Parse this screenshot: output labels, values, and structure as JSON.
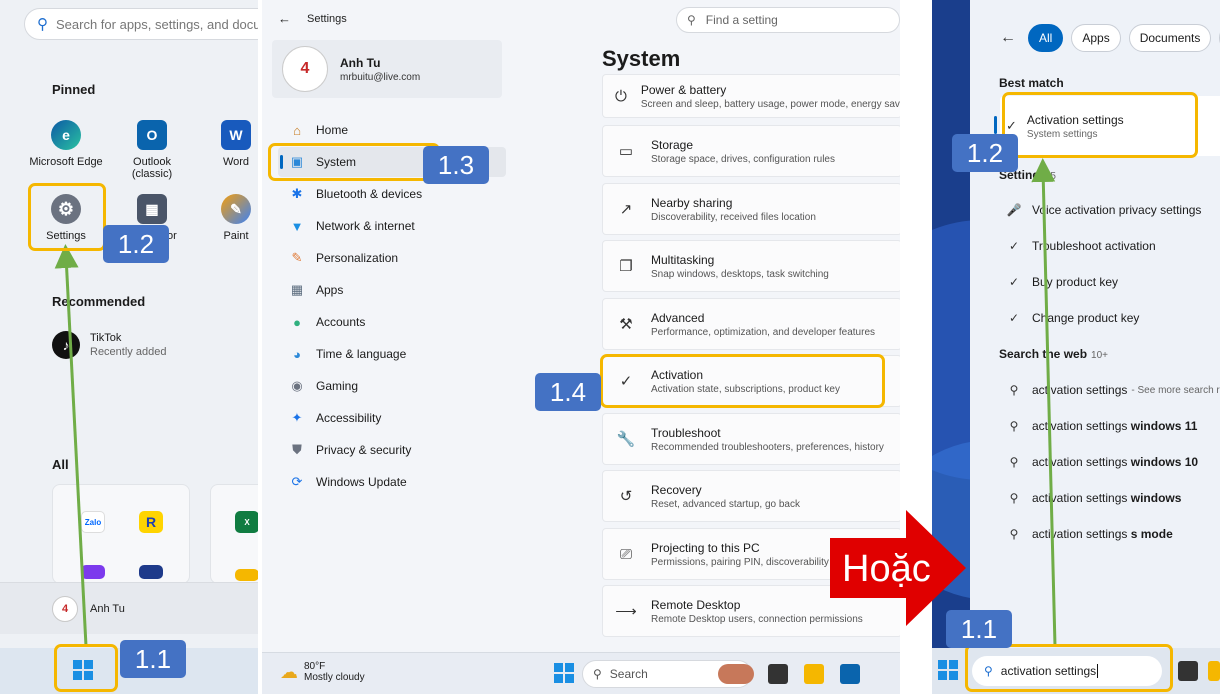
{
  "start_menu": {
    "search_placeholder": "Search for apps, settings, and documents",
    "pinned_heading": "Pinned",
    "pinned_apps": [
      "Microsoft Edge",
      "Outlook (classic)",
      "Word",
      "Settings",
      "Calculator",
      "Paint"
    ],
    "recommended_heading": "Recommended",
    "recommended_item": {
      "title": "TikTok",
      "subtitle": "Recently added"
    },
    "all_heading": "All",
    "folder_apps": [
      "Zalo"
    ],
    "user_name": "Anh Tu"
  },
  "settings": {
    "window_title": "Settings",
    "find_placeholder": "Find a setting",
    "user": {
      "name": "Anh Tu",
      "email": "mrbuitu@live.com"
    },
    "nav_items": [
      "Home",
      "System",
      "Bluetooth & devices",
      "Network & internet",
      "Personalization",
      "Apps",
      "Accounts",
      "Time & language",
      "Gaming",
      "Accessibility",
      "Privacy & security",
      "Windows Update"
    ],
    "selected_nav": "System",
    "page_title": "System",
    "cards": [
      {
        "title": "Power & battery",
        "subtitle": "Screen and sleep, battery usage, power mode, energy saver",
        "icon": "power-icon"
      },
      {
        "title": "Storage",
        "subtitle": "Storage space, drives, configuration rules",
        "icon": "storage-icon"
      },
      {
        "title": "Nearby sharing",
        "subtitle": "Discoverability, received files location",
        "icon": "share-icon"
      },
      {
        "title": "Multitasking",
        "subtitle": "Snap windows, desktops, task switching",
        "icon": "multitask-icon"
      },
      {
        "title": "Advanced",
        "subtitle": "Performance, optimization, and developer features",
        "icon": "tools-icon"
      },
      {
        "title": "Activation",
        "subtitle": "Activation state, subscriptions, product key",
        "icon": "check-circle-icon"
      },
      {
        "title": "Troubleshoot",
        "subtitle": "Recommended troubleshooters, preferences, history",
        "icon": "wrench-icon"
      },
      {
        "title": "Recovery",
        "subtitle": "Reset, advanced startup, go back",
        "icon": "recovery-icon"
      },
      {
        "title": "Projecting to this PC",
        "subtitle": "Permissions, pairing PIN, discoverability",
        "icon": "project-icon"
      },
      {
        "title": "Remote Desktop",
        "subtitle": "Remote Desktop users, connection permissions",
        "icon": "remote-icon"
      }
    ],
    "taskbar": {
      "weather_temp": "80°F",
      "weather_desc": "Mostly cloudy",
      "search_label": "Search"
    }
  },
  "search_panel": {
    "filters": [
      "All",
      "Apps",
      "Documents",
      "W"
    ],
    "best_match_heading": "Best match",
    "best_match": {
      "title": "Activation settings",
      "subtitle": "System settings"
    },
    "settings_heading": "Settings",
    "settings_count": "5",
    "settings_results": [
      "Voice activation privacy settings",
      "Troubleshoot activation",
      "Buy product key",
      "Change product key"
    ],
    "web_heading": "Search the web",
    "web_count": "10+",
    "web_results": [
      {
        "prefix": "activation settings",
        "bold": "",
        "more": "- See more search r"
      },
      {
        "prefix": "activation settings ",
        "bold": "windows 11",
        "more": ""
      },
      {
        "prefix": "activation settings ",
        "bold": "windows 10",
        "more": ""
      },
      {
        "prefix": "activation settings ",
        "bold": "windows",
        "more": ""
      },
      {
        "prefix": "activation settings ",
        "bold": "s mode",
        "more": ""
      }
    ],
    "taskbar_query": "activation settings"
  },
  "annotations": {
    "step_1_1": "1.1",
    "step_1_2": "1.2",
    "step_1_3": "1.3",
    "step_1_4": "1.4",
    "or_label": "Hoặc",
    "highlight_color": "#f5b700",
    "tag_color": "#4472c4",
    "arrow_color": "#70ad47",
    "big_arrow_color": "#e00000"
  }
}
